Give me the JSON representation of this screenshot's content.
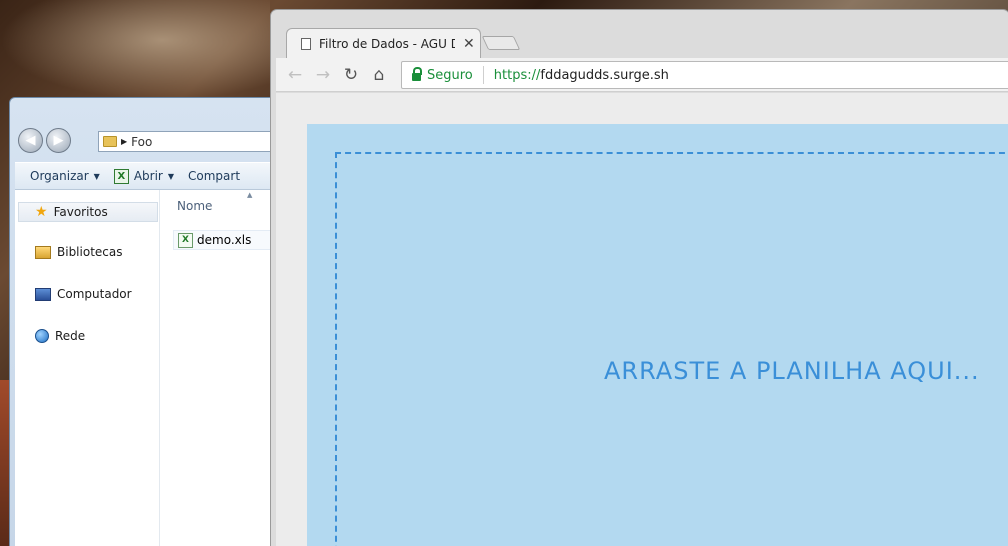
{
  "explorer": {
    "breadcrumb": "Foo",
    "toolbar": {
      "organize": "Organizar",
      "open": "Abrir",
      "share": "Compart"
    },
    "nav": {
      "favorites": "Favoritos",
      "libraries": "Bibliotecas",
      "computer": "Computador",
      "network": "Rede"
    },
    "column_name": "Nome",
    "files": [
      "demo.xls"
    ]
  },
  "browser": {
    "tab_title": "Filtro de Dados - AGU Do",
    "secure_label": "Seguro",
    "url_scheme": "https://",
    "url_host": "fddagudds.surge.sh"
  },
  "page": {
    "drop_text": "ARRASTE A PLANILHA AQUI..."
  }
}
